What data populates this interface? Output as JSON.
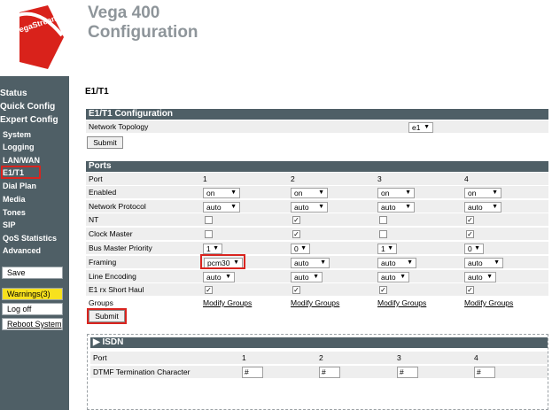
{
  "header": {
    "logo_text": "VegaStream",
    "title_line1": "Vega 400",
    "title_line2": "Configuration"
  },
  "sidebar": {
    "status": "Status",
    "quick_config": "Quick Config",
    "expert_config": "Expert Config",
    "items": [
      "System",
      "Logging",
      "LAN/WAN",
      "E1/T1",
      "Dial Plan",
      "Media",
      "Tones",
      "SIP",
      "QoS Statistics",
      "Advanced"
    ],
    "save": "Save",
    "warnings": "Warnings(3)",
    "log_off": "Log off",
    "reboot": "Reboot System"
  },
  "main": {
    "page_title": "E1/T1",
    "config_section": {
      "header": "E1/T1 Configuration",
      "network_topology_label": "Network Topology",
      "network_topology_value": "e1",
      "submit": "Submit"
    },
    "ports_section": {
      "header": "Ports",
      "port_label": "Port",
      "ports": [
        "1",
        "2",
        "3",
        "4"
      ],
      "rows": {
        "enabled": {
          "label": "Enabled",
          "values": [
            "on",
            "on",
            "on",
            "on"
          ]
        },
        "network_protocol": {
          "label": "Network Protocol",
          "values": [
            "auto",
            "auto",
            "auto",
            "auto"
          ]
        },
        "nt": {
          "label": "NT",
          "checked": [
            false,
            true,
            false,
            true
          ]
        },
        "clock_master": {
          "label": "Clock Master",
          "checked": [
            false,
            true,
            false,
            true
          ]
        },
        "bus_master_priority": {
          "label": "Bus Master Priority",
          "values": [
            "1",
            "0",
            "1",
            "0"
          ]
        },
        "framing": {
          "label": "Framing",
          "values": [
            "pcm30",
            "auto",
            "auto",
            "auto"
          ]
        },
        "line_encoding": {
          "label": "Line Encoding",
          "values": [
            "auto",
            "auto",
            "auto",
            "auto"
          ]
        },
        "e1_short_haul": {
          "label": "E1 rx Short Haul",
          "checked": [
            true,
            true,
            true,
            true
          ]
        },
        "groups": {
          "label": "Groups",
          "link": "Modify Groups"
        }
      },
      "submit": "Submit"
    },
    "isdn_section": {
      "header": "ISDN",
      "port_label": "Port",
      "ports": [
        "1",
        "2",
        "3",
        "4"
      ],
      "dtmf_label": "DTMF Termination Character",
      "dtmf_values": [
        "#",
        "#",
        "#",
        "#"
      ]
    }
  }
}
